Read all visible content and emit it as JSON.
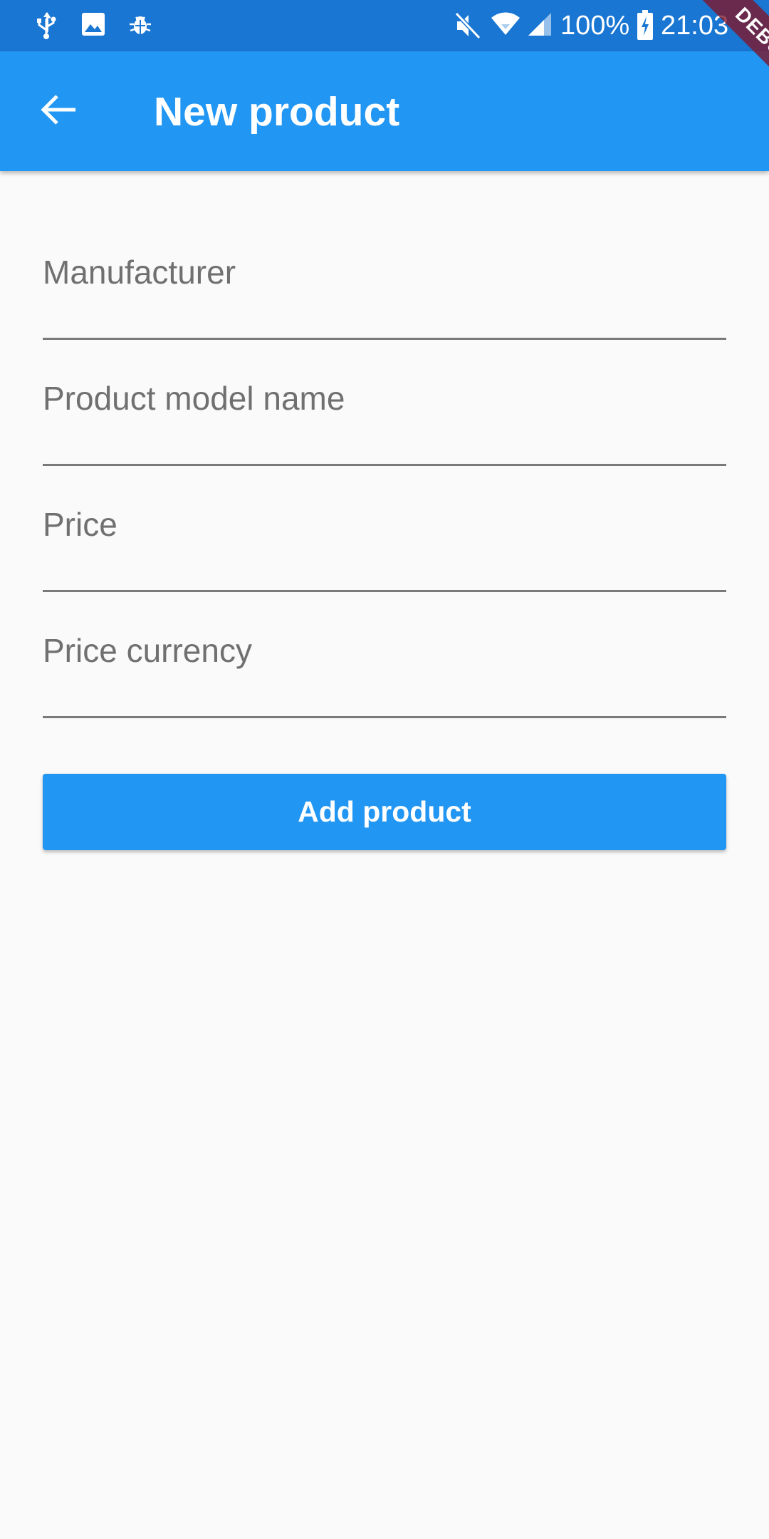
{
  "status_bar": {
    "battery": "100%",
    "time": "21:03",
    "icons": [
      "usb-icon",
      "image-icon",
      "bug-icon",
      "mute-icon",
      "wifi-icon",
      "signal-icon",
      "battery-charging-icon"
    ]
  },
  "debug_banner": "DEBUG",
  "app_bar": {
    "back_icon": "arrow-back-icon",
    "title": "New product"
  },
  "form": {
    "fields": [
      {
        "label": "Manufacturer",
        "value": ""
      },
      {
        "label": "Product model name",
        "value": ""
      },
      {
        "label": "Price",
        "value": ""
      },
      {
        "label": "Price currency",
        "value": ""
      }
    ],
    "submit_label": "Add product"
  },
  "colors": {
    "status_bar": "#1976d2",
    "app_bar": "#2196f3",
    "button": "#2196f3",
    "background": "#fafafa",
    "label_text": "#707070",
    "underline": "#7a7a7a",
    "debug_banner": "#801428"
  }
}
